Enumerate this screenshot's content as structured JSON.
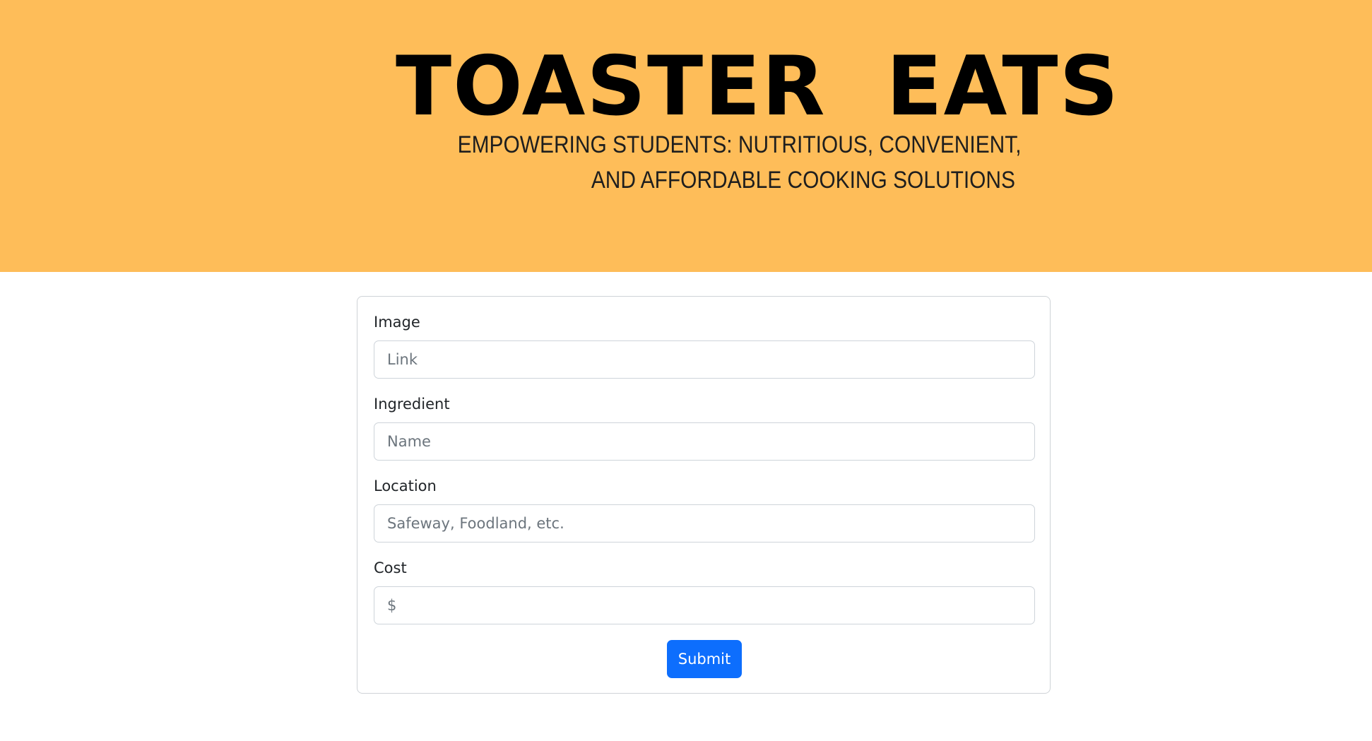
{
  "header": {
    "title": "TOASTER  EATS",
    "tagline_line1": "EMPOWERING STUDENTS: NUTRITIOUS, CONVENIENT,",
    "tagline_line2": "AND AFFORDABLE COOKING SOLUTIONS",
    "background_color": "#febd59"
  },
  "form": {
    "fields": [
      {
        "label": "Image",
        "placeholder": "Link",
        "value": ""
      },
      {
        "label": "Ingredient",
        "placeholder": "Name",
        "value": ""
      },
      {
        "label": "Location",
        "placeholder": "Safeway, Foodland, etc.",
        "value": ""
      },
      {
        "label": "Cost",
        "placeholder": "$",
        "value": ""
      }
    ],
    "submit_label": "Submit",
    "submit_color": "#0d6efd"
  }
}
